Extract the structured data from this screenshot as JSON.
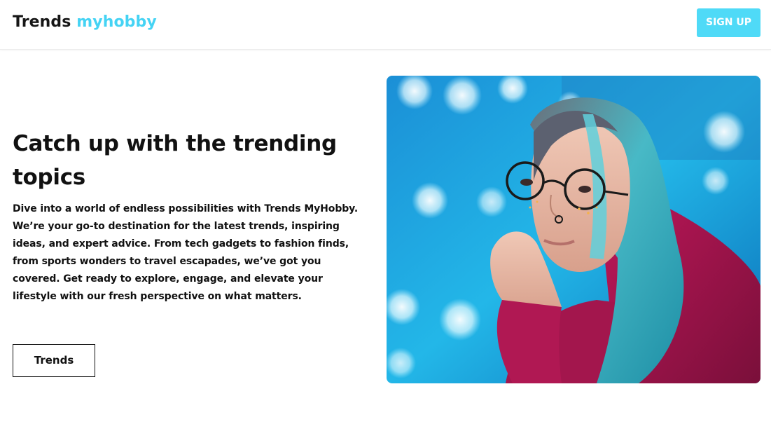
{
  "header": {
    "brand_main": "Trends",
    "brand_accent": "myhobby",
    "signup_label": "SIGN UP"
  },
  "hero": {
    "title": "Catch up with the trending topics",
    "description": "Dive into a world of endless possibilities with Trends MyHobby. We’re your go-to destination for the latest trends, inspiring ideas, and expert advice. From tech gadgets to fashion finds, from sports wonders to travel escapades, we’ve got you covered. Get ready to explore, engage, and elevate your lifestyle with our fresh perspective on what matters.",
    "button_label": "Trends",
    "image_alt": "hero-photo"
  },
  "colors": {
    "accent": "#45d3f4",
    "button_bg": "#4fdaf7",
    "text": "#111111"
  }
}
